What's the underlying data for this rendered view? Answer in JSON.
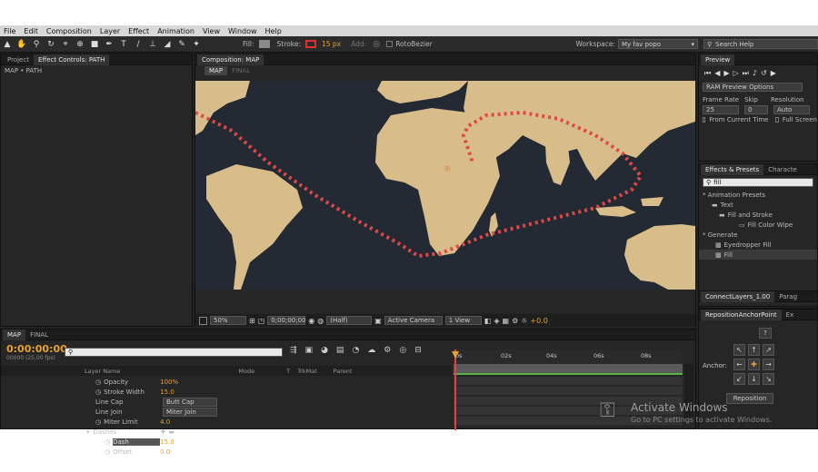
{
  "menu": [
    "File",
    "Edit",
    "Composition",
    "Layer",
    "Effect",
    "Animation",
    "View",
    "Window",
    "Help"
  ],
  "toolbar": {
    "fill_label": "Fill:",
    "stroke_label": "Stroke:",
    "stroke_width": "15 px",
    "add_label": "Add:",
    "rotobezier_label": "RotoBezier",
    "workspace_label": "Workspace:",
    "workspace_value": "My fav popo",
    "search_help": "Search Help",
    "fill_color": "#8a8a8a",
    "stroke_color": "#e03030"
  },
  "project_panel": {
    "tab_project": "Project",
    "tab_effect_controls": "Effect Controls: PATH",
    "breadcrumb": "MAP • PATH"
  },
  "composition": {
    "tab": "Composition: MAP",
    "subtabs": [
      "MAP",
      "FINAL"
    ],
    "zoom": "50%",
    "timecode": "0;00;00;00",
    "resolution": "(Half)",
    "camera": "Active Camera",
    "views": "1 View",
    "exposure": "+0.0",
    "ocean_color": "#232a33",
    "land_color": "#d8bc8a",
    "path_color": "#e04848"
  },
  "preview": {
    "tab": "Preview",
    "ram_preview": "RAM Preview Options",
    "frame_rate_label": "Frame Rate",
    "skip_label": "Skip",
    "resolution_label": "Resolution",
    "frame_rate": "25",
    "skip": "0",
    "resolution": "Auto",
    "from_current": "From Current Time",
    "full_screen": "Full Screen"
  },
  "effects_presets": {
    "tab": "Effects & Presets",
    "tab2": "Characte",
    "search_value": "fill",
    "tree": [
      {
        "label": "* Animation Presets",
        "indent": 0
      },
      {
        "label": "Text",
        "indent": 1
      },
      {
        "label": "Fill and Stroke",
        "indent": 2
      },
      {
        "label": "Fill Color Wipe",
        "indent": 3
      },
      {
        "label": "* Generate",
        "indent": 0
      },
      {
        "label": "Eyedropper Fill",
        "indent": 1
      },
      {
        "label": "Fill",
        "indent": 1
      }
    ]
  },
  "connect_panel": {
    "tab": "ConnectLayers_1.00",
    "tab2": "Parag"
  },
  "reposition_panel": {
    "tab": "RepositionAnchorPoint",
    "tab2": "Ex",
    "help": "?",
    "anchor_label": "Anchor:",
    "button": "Reposition"
  },
  "timeline": {
    "tabs": [
      "MAP",
      "FINAL"
    ],
    "timecode": "0:00:00:00",
    "fps": "00000 (25.00 fps)",
    "columns": [
      "Layer Name",
      "Mode",
      "T",
      "TrkMat",
      "Parent"
    ],
    "rows": [
      {
        "label": "Opacity",
        "value": "100%"
      },
      {
        "label": "Stroke Width",
        "value": "15.0"
      },
      {
        "label": "Line Cap",
        "value": "Butt Cap"
      },
      {
        "label": "Line Join",
        "value": "Miter Join"
      },
      {
        "label": "Miter Limit",
        "value": "4.0"
      },
      {
        "label": "Dashes",
        "value": ""
      },
      {
        "label": "Dash",
        "value": "15.0"
      },
      {
        "label": "Offset",
        "value": "0.0"
      }
    ],
    "ruler": [
      "0s",
      "02s",
      "04s",
      "06s",
      "08s"
    ]
  },
  "watermark": {
    "title": "Activate Windows",
    "subtitle": "Go to PC settings to activate Windows."
  }
}
